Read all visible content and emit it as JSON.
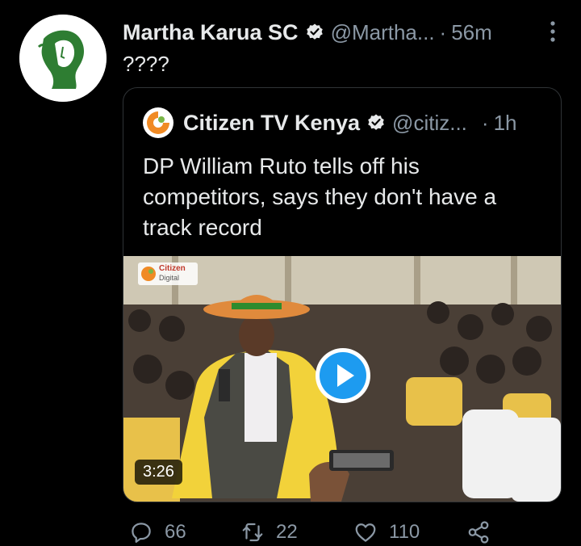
{
  "tweet": {
    "author_name": "Martha Karua SC",
    "handle": "@Martha...",
    "separator": "·",
    "time": "56m",
    "text": "????"
  },
  "quoted": {
    "author_name": "Citizen TV Kenya",
    "handle": "@citiz...",
    "separator": "·",
    "time": "1h",
    "text": "DP William Ruto tells off his competitors, says they don't have a track record",
    "video": {
      "duration": "3:26",
      "watermark_line1": "Citizen",
      "watermark_line2": "Digital"
    }
  },
  "actions": {
    "replies": "66",
    "retweets": "22",
    "likes": "110"
  },
  "icons": {
    "verified": "verified-badge-icon",
    "more": "more-vertical-icon",
    "reply": "reply-icon",
    "retweet": "retweet-icon",
    "like": "heart-icon",
    "share": "share-icon",
    "play": "play-icon"
  },
  "colors": {
    "background": "#000000",
    "text": "#e7e9ea",
    "muted": "#8b98a5",
    "accent": "#1d9bf0",
    "avatar_green": "#2e7d32"
  }
}
